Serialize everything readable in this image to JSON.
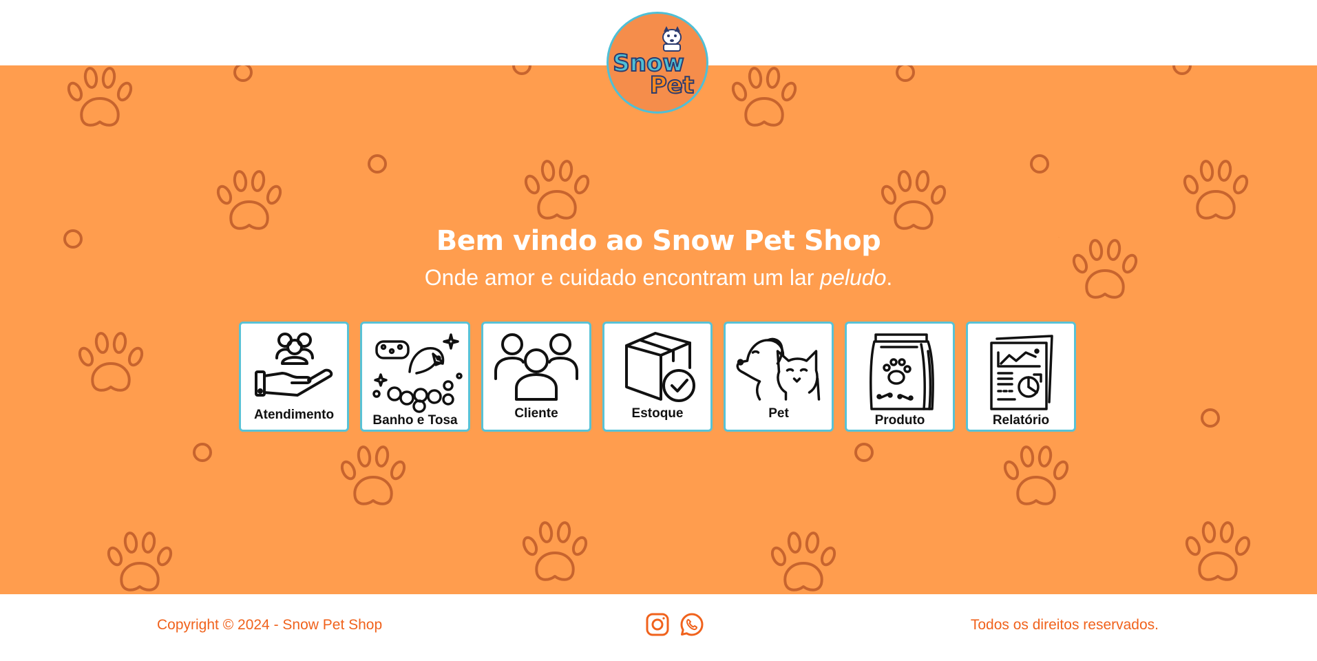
{
  "brand": {
    "logo_line1": "Snow",
    "logo_line2": "Pet"
  },
  "hero": {
    "title": "Bem vindo ao Snow Pet Shop",
    "subtitle_prefix": "Onde amor e cuidado encontram um lar ",
    "subtitle_emphasis": "peludo",
    "subtitle_suffix": "."
  },
  "menu": {
    "items": [
      {
        "label": "Atendimento",
        "icon": "hand-people-icon"
      },
      {
        "label": "Banho e Tosa",
        "icon": "dog-bath-icon"
      },
      {
        "label": "Cliente",
        "icon": "clients-group-icon"
      },
      {
        "label": "Estoque",
        "icon": "box-check-icon"
      },
      {
        "label": "Pet",
        "icon": "dog-cat-icon"
      },
      {
        "label": "Produto",
        "icon": "pet-food-bag-icon"
      },
      {
        "label": "Relatório",
        "icon": "report-chart-icon"
      }
    ]
  },
  "footer": {
    "copyright": "Copyright © 2024 - Snow Pet Shop",
    "rights": "Todos os direitos reservados.",
    "social": [
      "instagram-icon",
      "whatsapp-icon"
    ]
  },
  "colors": {
    "hero_background": "#ff9d4e",
    "paw_pattern": "#c7642e",
    "card_border": "#58c2d6",
    "footer_text": "#f0621c",
    "logo_ring": "#4fbfd6"
  }
}
